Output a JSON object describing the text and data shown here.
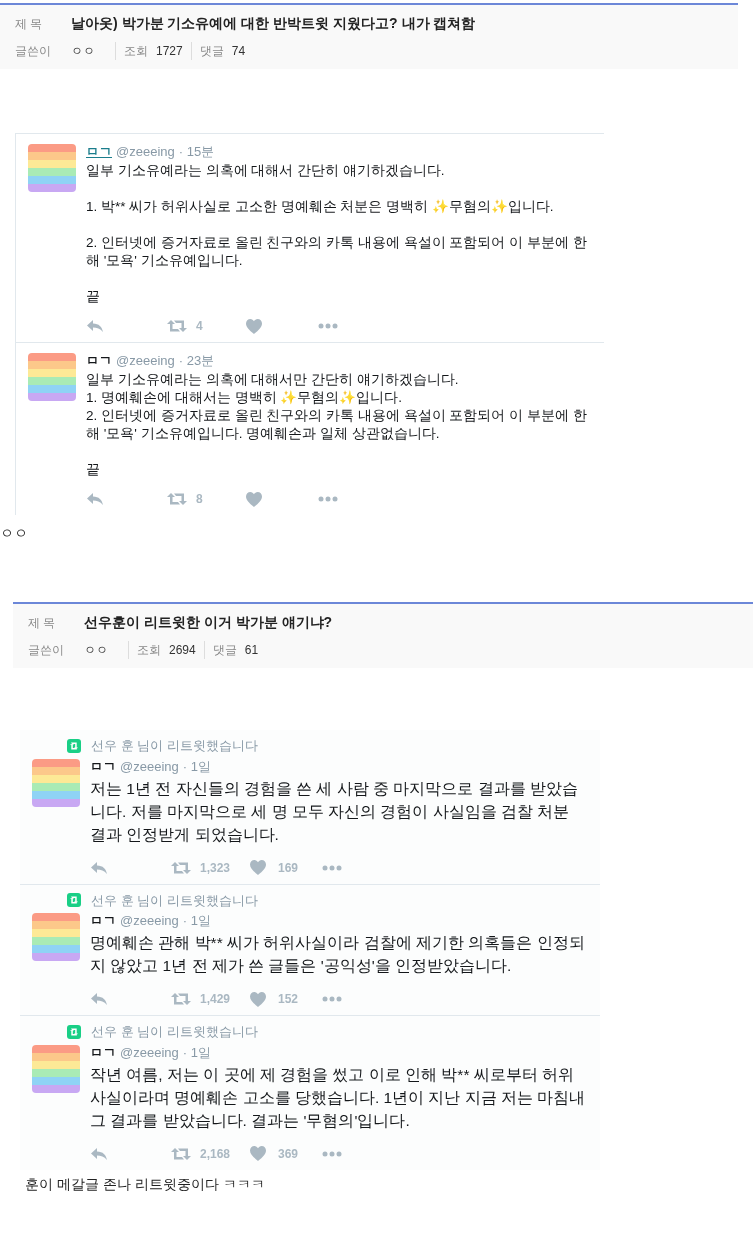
{
  "posts": [
    {
      "title_label": "제 목",
      "title": "날아옷) 박가분 기소유예에 대한 반박트윗 지웠다고? 내가 캡쳐함",
      "author_label": "글쓴이",
      "author": "ㅇㅇ",
      "views_label": "조회",
      "views": "1727",
      "comments_label": "댓글",
      "comments": "74",
      "tweets": [
        {
          "name": "ㅁㄱ",
          "handle": "@zeeeing",
          "time": "· 15분",
          "paragraphs": [
            [
              "일부 기소유예라는 의혹에 대해서 간단히 얘기하겠습니다."
            ],
            [
              "1. 박** 씨가 허위사실로 고소한 명예훼손 처분은 명백히 ✨무혐의✨입니다."
            ],
            [
              "2. 인터넷에 증거자료로 올린 친구와의 카톡 내용에 욕설이 포함되어 이 부분에 한해 '모욕' 기소유예입니다."
            ],
            [
              "끝"
            ]
          ],
          "retweets": "4"
        },
        {
          "name": "ㅁㄱ",
          "handle": "@zeeeing",
          "time": "· 23분",
          "paragraphs": [
            [
              "일부 기소유예라는 의혹에 대해서만 간단히 얘기하겠습니다.",
              "1. 명예훼손에 대해서는 명백히 ✨무혐의✨입니다.",
              "2. 인터넷에 증거자료로 올린 친구와의 카톡 내용에 욕설이 포함되어 이 부분에 한해 '모욕' 기소유예입니다. 명예훼손과 일체 상관없습니다."
            ],
            [
              "끝"
            ]
          ],
          "retweets": "8"
        }
      ],
      "caption": "ㅇㅇ"
    },
    {
      "title_label": "제 목",
      "title": "선우훈이 리트윗한 이거 박가분 얘기냐?",
      "author_label": "글쓴이",
      "author": "ㅇㅇ",
      "views_label": "조회",
      "views": "2694",
      "comments_label": "댓글",
      "comments": "61",
      "tweets": [
        {
          "retweeted_by": "선우 훈 님이 리트윗했습니다",
          "name": "ㅁㄱ",
          "handle": "@zeeeing",
          "time": "· 1일",
          "paragraphs": [
            [
              "저는 1년 전 자신들의 경험을 쓴 세 사람 중 마지막으로 결과를 받았습니다. 저를 마지막으로 세 명 모두 자신의 경험이 사실임을 검찰 처분 결과 인정받게 되었습니다."
            ]
          ],
          "retweets": "1,323",
          "likes": "169"
        },
        {
          "retweeted_by": "선우 훈 님이 리트윗했습니다",
          "name": "ㅁㄱ",
          "handle": "@zeeeing",
          "time": "· 1일",
          "paragraphs": [
            [
              "명예훼손 관해 박** 씨가 허위사실이라 검찰에 제기한 의혹들은 인정되지 않았고 1년 전 제가 쓴 글들은 '공익성'을 인정받았습니다."
            ]
          ],
          "retweets": "1,429",
          "likes": "152"
        },
        {
          "retweeted_by": "선우 훈 님이 리트윗했습니다",
          "name": "ㅁㄱ",
          "handle": "@zeeeing",
          "time": "· 1일",
          "paragraphs": [
            [
              "작년 여름, 저는 이 곳에 제 경험을 썼고 이로 인해 박** 씨로부터 허위사실이라며 명예훼손 고소를 당했습니다. 1년이 지난 지금 저는 마침내 그 결과를 받았습니다. 결과는 '무혐의'입니다."
            ]
          ],
          "retweets": "2,168",
          "likes": "369"
        }
      ],
      "caption": "훈이 메갈글 존나 리트윗중이다 ㅋㅋㅋ"
    }
  ]
}
